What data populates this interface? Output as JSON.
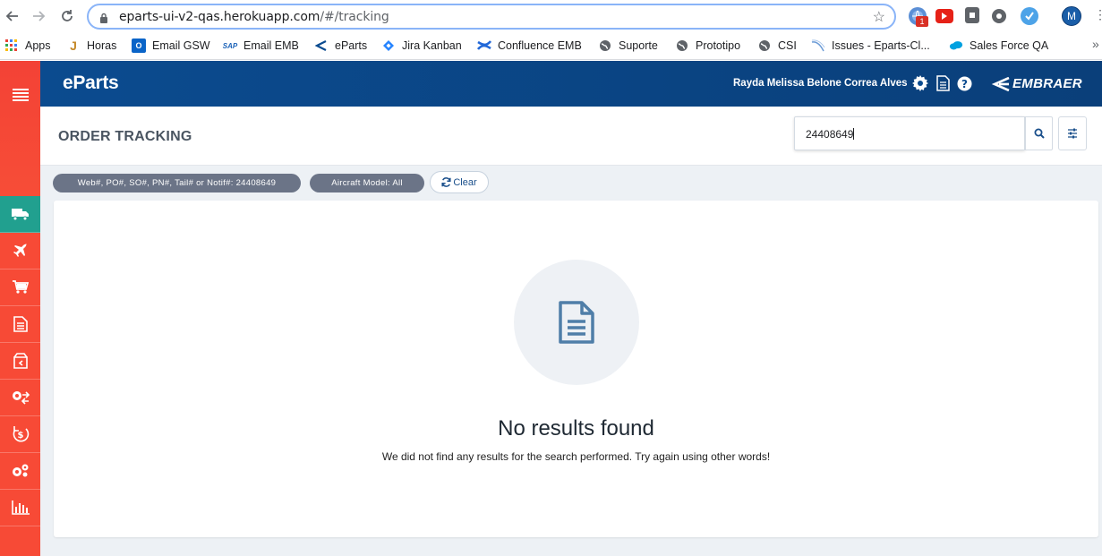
{
  "browser": {
    "url_host": "eparts-ui-v2-qas.herokuapp.com",
    "url_path": "/#/tracking",
    "extension_badge": "1",
    "profile_initial": "M",
    "bookmarks": [
      {
        "label": "Apps",
        "icon": "apps-grid-icon"
      },
      {
        "label": "Horas",
        "icon": "horas-icon"
      },
      {
        "label": "Email GSW",
        "icon": "outlook-icon"
      },
      {
        "label": "Email EMB",
        "icon": "sap-icon"
      },
      {
        "label": "eParts",
        "icon": "embraer-icon"
      },
      {
        "label": "Jira Kanban",
        "icon": "jira-icon"
      },
      {
        "label": "Confluence EMB",
        "icon": "confluence-icon"
      },
      {
        "label": "Suporte",
        "icon": "globe-icon"
      },
      {
        "label": "Prototipo",
        "icon": "globe-icon"
      },
      {
        "label": "CSI",
        "icon": "globe-icon"
      },
      {
        "label": "Issues - Eparts-Cl...",
        "icon": "issues-icon"
      },
      {
        "label": "Sales Force QA",
        "icon": "salesforce-icon"
      }
    ]
  },
  "header": {
    "brand": "eParts",
    "username": "Rayda Melissa Belone Correa Alves",
    "logo_text": "EMBRAER"
  },
  "page": {
    "title": "ORDER TRACKING",
    "search_value": "24408649"
  },
  "filters": {
    "chip_search": "Web#, PO#, SO#, PN#, Tail# or Notif#: 24408649",
    "chip_model": "Aircraft Model: All",
    "clear_label": "Clear"
  },
  "empty_state": {
    "title": "No results found",
    "description": "We did not find any results for the search performed. Try again using other words!"
  },
  "sidebar": {
    "items": [
      {
        "icon": "truck-icon",
        "active": true
      },
      {
        "icon": "airplane-icon",
        "active": false
      },
      {
        "icon": "cart-icon",
        "active": false
      },
      {
        "icon": "document-icon",
        "active": false
      },
      {
        "icon": "box-return-icon",
        "active": false
      },
      {
        "icon": "exchange-icon",
        "active": false
      },
      {
        "icon": "dollar-refresh-icon",
        "active": false
      },
      {
        "icon": "gears-icon",
        "active": false
      },
      {
        "icon": "bar-chart-icon",
        "active": false
      }
    ]
  },
  "colors": {
    "sidebar": "#f74a36",
    "sidebar_active": "#21a08f",
    "header": "#0b4b8f",
    "chip": "#6b7487",
    "icon_doc": "#4f7ea8"
  }
}
